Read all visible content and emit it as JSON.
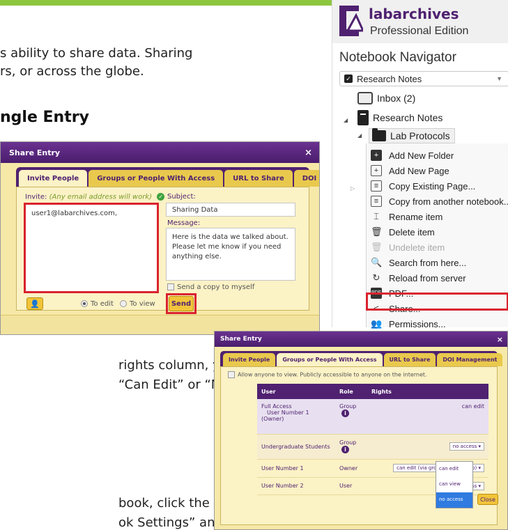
{
  "doc": {
    "line1": "s ability to share data. Sharing",
    "line2": "rs, or across the globe.",
    "heading": "ngle Entry",
    "line3": "rights column, you",
    "line4": "“Can Edit” or “No",
    "line5": "book, click the triple",
    "line6": "ok Settings” and go"
  },
  "share_dialog_invite": {
    "title": "Share Entry",
    "close": "×",
    "tabs": [
      "Invite People",
      "Groups or People With Access",
      "URL to Share",
      "DOI Management"
    ],
    "invite_label": "Invite:",
    "invite_hint": "(Any email address will work)",
    "invite_value": "user1@labarchives.com,",
    "subject_label": "Subject:",
    "subject_value": "Sharing Data",
    "message_label": "Message:",
    "message_value": "Here is the data we talked about. Please let me know if you need anything else.",
    "copy_label": "Send a copy to myself",
    "radio_edit": "To edit",
    "radio_view": "To view",
    "send_label": "Send",
    "colors": {
      "purple": "#4f2170",
      "gold": "#f2c43a",
      "highlight_red": "#d9232e"
    }
  },
  "navigator": {
    "brand": "labarchives",
    "edition": "Professional Edition",
    "title": "Notebook Navigator",
    "selected_notebook": "Research Notes",
    "inbox": "Inbox (2)",
    "notebook": "Research Notes",
    "folder": "Lab Protocols",
    "menu_items": [
      {
        "label": "Add New Folder",
        "icon": "add-folder-icon",
        "disabled": false
      },
      {
        "label": "Add New Page",
        "icon": "add-page-icon",
        "disabled": false
      },
      {
        "label": "Copy Existing Page...",
        "icon": "copy-page-icon",
        "disabled": false
      },
      {
        "label": "Copy from another notebook...",
        "icon": "copy-notebook-icon",
        "disabled": false
      },
      {
        "label": "Rename item",
        "icon": "rename-icon",
        "disabled": false
      },
      {
        "label": "Delete item",
        "icon": "trash-icon",
        "disabled": false
      },
      {
        "label": "Undelete item",
        "icon": "undelete-icon",
        "disabled": true
      },
      {
        "label": "Search from here...",
        "icon": "search-icon",
        "disabled": false
      },
      {
        "label": "Reload from server",
        "icon": "reload-icon",
        "disabled": false
      },
      {
        "label": "PDF...",
        "icon": "pdf-icon",
        "disabled": false
      },
      {
        "label": "Share...",
        "icon": "share-icon",
        "disabled": false
      },
      {
        "label": "Permissions...",
        "icon": "permissions-icon",
        "disabled": false
      }
    ]
  },
  "share_dialog_groups": {
    "title": "Share Entry",
    "close": "×",
    "tabs": [
      "Invite People",
      "Groups or People With Access",
      "URL to Share",
      "DOI Management"
    ],
    "allow_label": "Allow anyone to view. Publicly accessible to anyone on the internet.",
    "headers": [
      "User",
      "Role",
      "Rights"
    ],
    "rows": [
      {
        "user": "Full Access",
        "sub1": "User Number 1",
        "sub2": "(Owner)",
        "role": "Group",
        "rights": "can edit"
      },
      {
        "user": "Undergraduate Students",
        "role": "Group",
        "rights": "no access ▾"
      },
      {
        "user": "User Number 1",
        "role": "Owner",
        "rights": "can edit (via group membership) ▾"
      },
      {
        "user": "User Number 2",
        "role": "User",
        "rights": "no access ▾"
      }
    ],
    "dropdown_options": [
      "can edit",
      "can view",
      "no access"
    ],
    "close_label": "Close"
  }
}
